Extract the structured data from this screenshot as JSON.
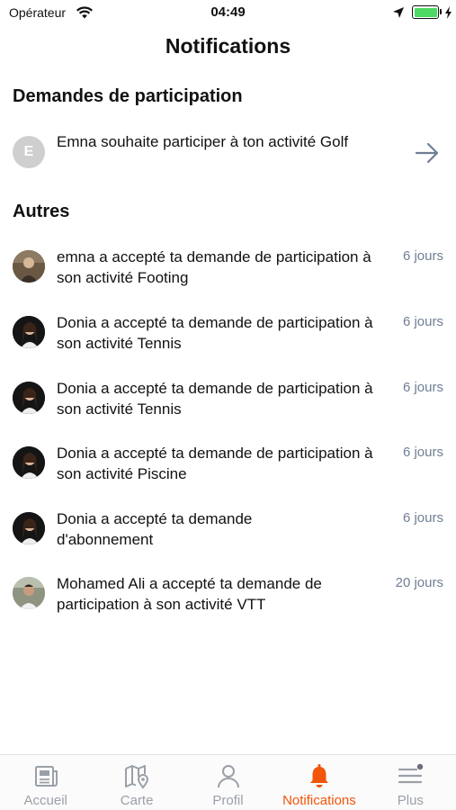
{
  "status_bar": {
    "carrier": "Opérateur",
    "time": "04:49"
  },
  "page": {
    "title": "Notifications"
  },
  "sections": {
    "requests_title": "Demandes de participation",
    "others_title": "Autres"
  },
  "request": {
    "avatar_letter": "E",
    "text": "Emna souhaite participer à ton activité Golf"
  },
  "notifications": [
    {
      "text": "emna a accepté ta demande de participation à son activité Footing",
      "time": "6 jours"
    },
    {
      "text": "Donia a accepté ta demande de participation à son activité Tennis",
      "time": "6 jours"
    },
    {
      "text": "Donia a accepté ta demande de participation à son activité Tennis",
      "time": "6 jours"
    },
    {
      "text": "Donia a accepté ta demande de participation à son activité Piscine",
      "time": "6 jours"
    },
    {
      "text": "Donia a accepté ta demande d'abonnement",
      "time": "6 jours"
    },
    {
      "text": "Mohamed Ali a accepté ta demande de participation à son activité VTT",
      "time": "20 jours"
    }
  ],
  "tabs": [
    {
      "label": "Accueil",
      "icon": "news-icon"
    },
    {
      "label": "Carte",
      "icon": "map-icon"
    },
    {
      "label": "Profil",
      "icon": "profile-icon"
    },
    {
      "label": "Notifications",
      "icon": "bell-icon",
      "active": true
    },
    {
      "label": "Plus",
      "icon": "menu-icon"
    }
  ],
  "colors": {
    "accent": "#f2540a",
    "time_text": "#6f7e94",
    "tab_inactive": "#9aa0a8",
    "battery": "#4cd964"
  }
}
